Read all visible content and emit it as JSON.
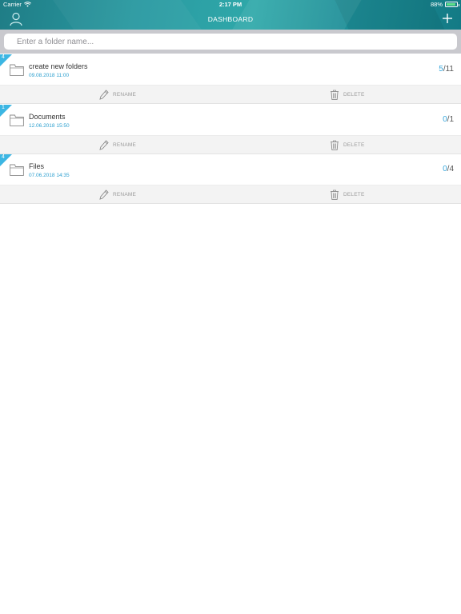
{
  "status_bar": {
    "carrier": "Carrier",
    "time": "2:17 PM",
    "battery": "88%",
    "battery_level": 0.88
  },
  "nav": {
    "title": "DASHBOARD",
    "left_icon": "person-icon",
    "right_icon": "plus-icon"
  },
  "search": {
    "placeholder": "Enter a folder name...",
    "value": ""
  },
  "folders": [
    {
      "badge": "4",
      "name": "create new folders",
      "date": "09.08.2018 11:00",
      "done": "5",
      "sep": "/",
      "total": "11",
      "rename_label": "RENAME",
      "delete_label": "DELETE"
    },
    {
      "badge": "1",
      "name": "Documents",
      "date": "12.06.2018 15:50",
      "done": "0",
      "sep": "/",
      "total": "1",
      "rename_label": "RENAME",
      "delete_label": "DELETE"
    },
    {
      "badge": "4",
      "name": "Files",
      "date": "07.06.2018 14:35",
      "done": "0",
      "sep": "/",
      "total": "4",
      "rename_label": "RENAME",
      "delete_label": "DELETE"
    }
  ],
  "colors": {
    "header": "#2a9aa2",
    "accent": "#3cb6e3",
    "date": "#2b9fcf"
  }
}
